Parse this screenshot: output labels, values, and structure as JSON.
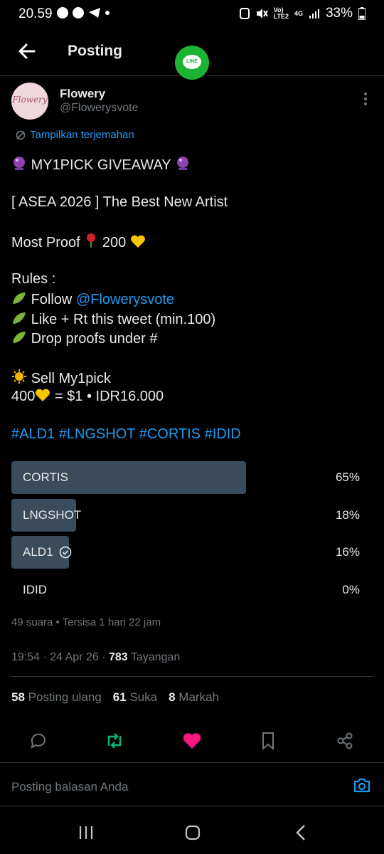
{
  "status_bar": {
    "time": "20.59",
    "battery": "33%",
    "network_top": "Vo)",
    "network_bottom": "LTE2",
    "network_type": "4G"
  },
  "header": {
    "title": "Posting"
  },
  "post": {
    "author_name": "Flowery",
    "author_handle": "@Flowerysvote",
    "avatar_text": "Flowery",
    "translate_label": "Tampilkan terjemahan",
    "line1": "MY1PICK GIVEAWAY",
    "line2": "[ ASEA 2026 ] The Best New Artist",
    "line3_prefix": "Most Proof",
    "line3_value": "200",
    "rules_title": "Rules :",
    "rule1_prefix": "Follow",
    "rule1_mention": "@Flowerysvote",
    "rule2": "Like + Rt this tweet  (min.100)",
    "rule3": "Drop proofs under #",
    "sell_line": "Sell My1pick",
    "price_prefix": "400",
    "price_rest": "= $1 • IDR16.000",
    "hashtags": "#ALD1 #LNGSHOT #CORTIS #IDID"
  },
  "poll": {
    "options": [
      {
        "label": "CORTIS",
        "percent_text": "65%",
        "percent": 65,
        "selected": false
      },
      {
        "label": "LNGSHOT",
        "percent_text": "18%",
        "percent": 18,
        "selected": false
      },
      {
        "label": "ALD1",
        "percent_text": "16%",
        "percent": 16,
        "selected": true
      },
      {
        "label": "IDID",
        "percent_text": "0%",
        "percent": 0,
        "selected": false
      }
    ],
    "summary": "49 suara • Tersisa 1 hari 22 jam"
  },
  "meta": {
    "timestamp": "19:54 · 24 Apr 26 · ",
    "views_count": "783",
    "views_label": " Tayangan"
  },
  "stats": {
    "reposts_count": "58",
    "reposts_label": "Posting ulang",
    "likes_count": "61",
    "likes_label": "Suka",
    "bookmarks_count": "8",
    "bookmarks_label": "Markah"
  },
  "reply": {
    "placeholder": "Posting balasan Anda"
  },
  "colors": {
    "accent": "#1d9bf0",
    "repost": "#00ba7c",
    "like": "#f91880",
    "poll_bar": "#3a4c5c"
  }
}
